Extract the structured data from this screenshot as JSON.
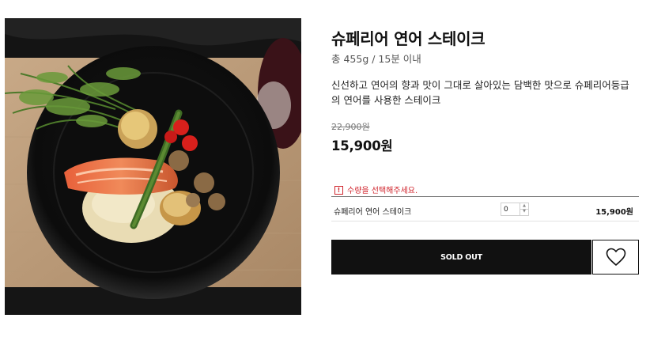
{
  "product": {
    "title": "슈페리어 연어 스테이크",
    "subtitle": "총 455g / 15분 이내",
    "description": "신선하고 연어의 향과 맛이 그대로 살아있는 담백한 맛으로 슈페리어등급의 연어를 사용한 스테이크",
    "original_price": "22,900원",
    "sale_price": "15,900원",
    "image_icon": "salmon-steak-photo"
  },
  "order": {
    "warning_icon": "!",
    "warning_text": "수량을 선택해주세요.",
    "option_name": "슈페리어 연어 스테이크",
    "quantity": "0",
    "stepper_up": "▲",
    "stepper_down": "▼",
    "option_price": "15,900원"
  },
  "actions": {
    "sold_out_label": "SOLD OUT",
    "wishlist_icon": "heart-icon"
  },
  "colors": {
    "accent_red": "#d0252d",
    "button_black": "#111111"
  }
}
